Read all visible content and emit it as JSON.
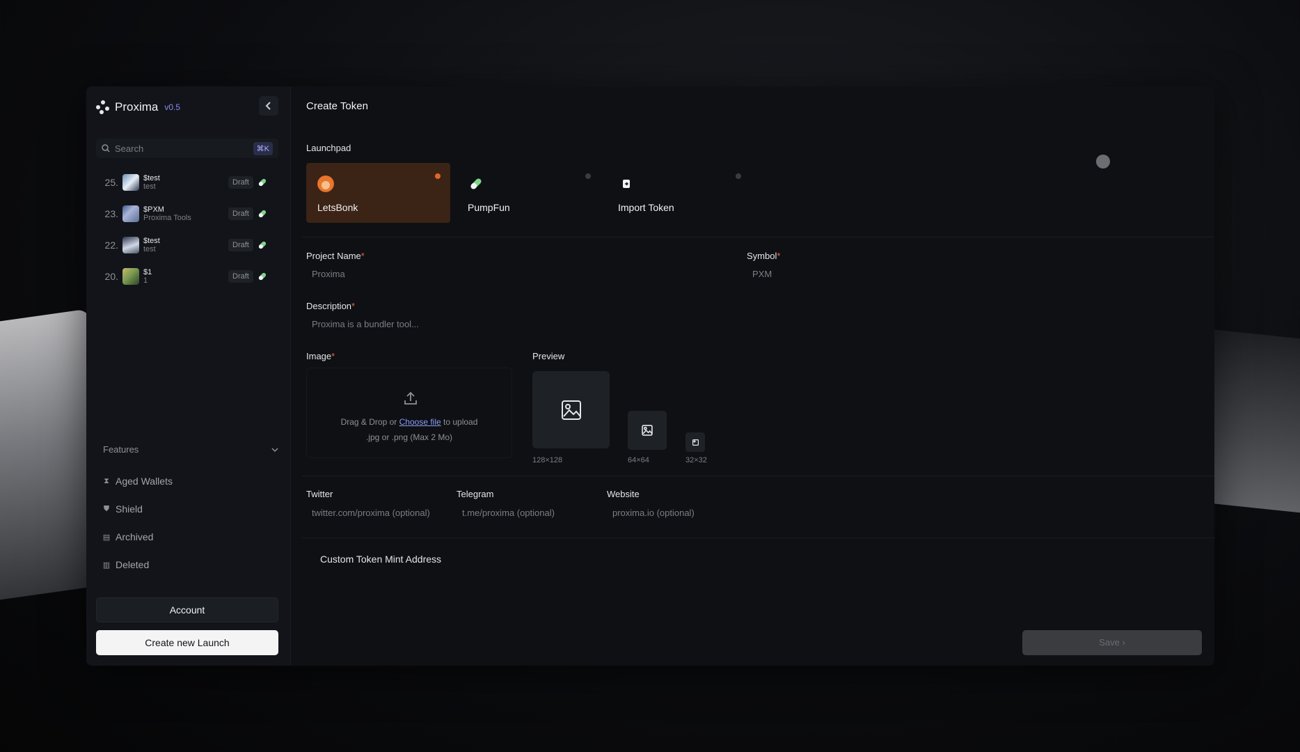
{
  "brand": {
    "name": "Proxima",
    "version": "v0.5"
  },
  "search": {
    "placeholder": "Search",
    "shortcut": "⌘K"
  },
  "launches": [
    {
      "number": "25.",
      "name": "$test",
      "sub": "test",
      "status": "Draft"
    },
    {
      "number": "23.",
      "name": "$PXM",
      "sub": "Proxima Tools",
      "status": "Draft"
    },
    {
      "number": "22.",
      "name": "$test",
      "sub": "test",
      "status": "Draft"
    },
    {
      "number": "20.",
      "name": "$1",
      "sub": "1",
      "status": "Draft"
    }
  ],
  "features": {
    "title": "Features",
    "items": [
      {
        "label": "Aged Wallets",
        "icon": "hourglass-icon"
      },
      {
        "label": "Shield",
        "icon": "shield-icon"
      },
      {
        "label": "Archived",
        "icon": "archive-icon"
      },
      {
        "label": "Deleted",
        "icon": "trash-icon"
      }
    ]
  },
  "sidebar_buttons": {
    "account": "Account",
    "create": "Create new Launch"
  },
  "main": {
    "title": "Create Token",
    "launchpad_label": "Launchpad",
    "launchpads": [
      {
        "name": "LetsBonk",
        "selected": true
      },
      {
        "name": "PumpFun",
        "selected": false
      },
      {
        "name": "Import Token",
        "selected": false
      }
    ],
    "project_name": {
      "label": "Project Name",
      "placeholder": "Proxima"
    },
    "symbol": {
      "label": "Symbol",
      "placeholder": "PXM"
    },
    "description": {
      "label": "Description",
      "placeholder": "Proxima is a bundler tool..."
    },
    "image": {
      "label": "Image",
      "drop_text_1": "Drag & Drop or",
      "choose_file": "Choose file",
      "drop_text_2": "to upload",
      "formats": ".jpg or .png (Max 2 Mo)"
    },
    "preview": {
      "label": "Preview",
      "sizes": [
        "128×128",
        "64×64",
        "32×32"
      ]
    },
    "twitter": {
      "label": "Twitter",
      "placeholder": "twitter.com/proxima (optional)"
    },
    "telegram": {
      "label": "Telegram",
      "placeholder": "t.me/proxima (optional)"
    },
    "website": {
      "label": "Website",
      "placeholder": "proxima.io (optional)"
    },
    "custom_mint": "Custom Token Mint Address",
    "save": "Save",
    "required_marker": "*"
  },
  "colors": {
    "accent": "#e0652a",
    "link": "#8a9cf6",
    "badge": "#aeb0ff"
  }
}
